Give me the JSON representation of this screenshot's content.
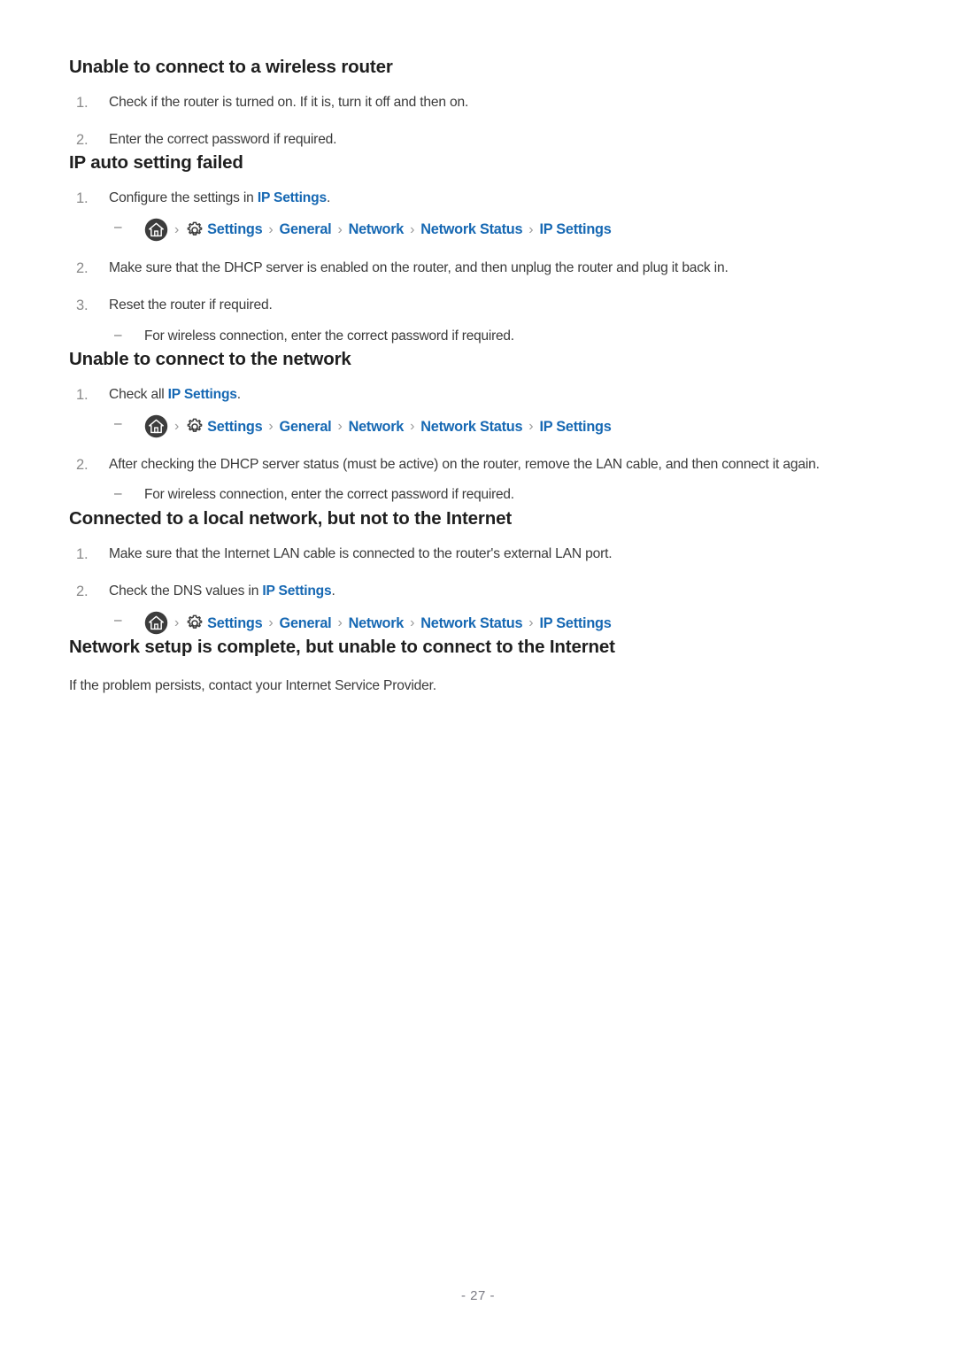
{
  "document": {
    "page_number": "- 27 -"
  },
  "icons": {
    "home": "home-icon",
    "gear": "gear-icon",
    "chevron": "›",
    "dash": "–"
  },
  "colors": {
    "link_blue": "#1668b3",
    "heading": "#1f1f1f",
    "body": "#3a3a3a",
    "list_number": "#8a8a8a",
    "chevron": "#9a9a9a",
    "home_circle": "#3c3c3c",
    "page_number": "#7b7b84"
  },
  "breadcrumb": {
    "items": [
      "Settings",
      "General",
      "Network",
      "Network Status",
      "IP Settings"
    ],
    "separator": "›"
  },
  "sections": [
    {
      "heading": "Unable to connect to a wireless router",
      "steps": [
        {
          "number": "1.",
          "text": "Check if the router is turned on. If it is, turn it off and then on."
        },
        {
          "number": "2.",
          "text": "Enter the correct password if required."
        }
      ]
    },
    {
      "heading": "IP auto setting failed",
      "steps": [
        {
          "number": "1.",
          "text_before": "Configure the settings in ",
          "link": "IP Settings",
          "text_after": "."
        },
        {
          "number": "2.",
          "text": "Make sure that the DHCP server is enabled on the router, and then unplug the router and plug it back in."
        },
        {
          "number": "3.",
          "text": "Reset the router if required.",
          "sub": "For wireless connection, enter the correct password if required."
        }
      ]
    },
    {
      "heading": "Unable to connect to the network",
      "steps": [
        {
          "number": "1.",
          "text_before": "Check all ",
          "link": "IP Settings",
          "text_after": "."
        },
        {
          "number": "2.",
          "text": "After checking the DHCP server status (must be active) on the router, remove the LAN cable, and then connect it again.",
          "sub": "For wireless connection, enter the correct password if required."
        }
      ]
    },
    {
      "heading": "Connected to a local network, but not to the Internet",
      "steps": [
        {
          "number": "1.",
          "text": "Make sure that the Internet LAN cable is connected to the router's external LAN port."
        },
        {
          "number": "2.",
          "text_before": "Check the DNS values in ",
          "link": "IP Settings",
          "text_after": "."
        }
      ]
    },
    {
      "heading": "Network setup is complete, but unable to connect to the Internet",
      "paragraph": "If the problem persists, contact your Internet Service Provider."
    }
  ]
}
